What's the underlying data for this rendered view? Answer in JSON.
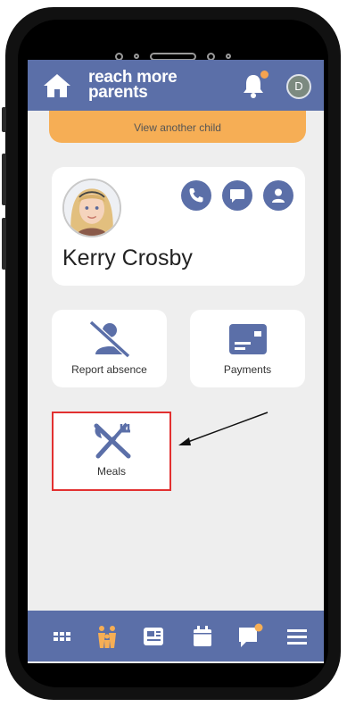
{
  "header": {
    "brand_line1": "reach more",
    "brand_line2": "parents",
    "avatar_letter": "D",
    "notification_badge_color": "#f5a350",
    "header_color": "#5b6fa8"
  },
  "banner": {
    "label": "View another child",
    "color": "#f6ae55"
  },
  "child": {
    "name": "Kerry Crosby",
    "actions": [
      "phone-icon",
      "message-icon",
      "profile-icon"
    ]
  },
  "tiles": {
    "report_absence": "Report absence",
    "payments": "Payments",
    "meals": "Meals"
  },
  "bottom_nav": {
    "items": [
      "apps-grid-icon",
      "family-icon",
      "newspaper-icon",
      "calendar-icon",
      "chat-icon",
      "menu-icon"
    ],
    "active": "family-icon",
    "active_color": "#f6ae55"
  }
}
